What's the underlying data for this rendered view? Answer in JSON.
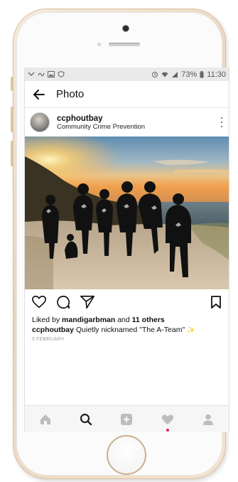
{
  "statusbar": {
    "battery": "73%",
    "time": "11:30"
  },
  "appbar": {
    "title": "Photo"
  },
  "post": {
    "username": "ccphoutbay",
    "location": "Community Crime Prevention",
    "liked_by_prefix": "Liked by ",
    "liked_by_user": "mandigarbman",
    "liked_by_and": " and ",
    "liked_by_others": "11 others",
    "caption_user": "ccphoutbay",
    "caption_text": " Quietly nicknamed \"The A-Team\"",
    "caption_emoji": "✨",
    "date": "5 FEBRUARY"
  },
  "icons": {
    "back": "back-arrow-icon",
    "more": "more-options-icon",
    "like": "heart-outline-icon",
    "comment": "comment-bubble-icon",
    "share": "direct-send-icon",
    "save": "bookmark-icon",
    "tabs": [
      "home-icon",
      "search-icon",
      "add-post-icon",
      "activity-heart-icon",
      "profile-icon"
    ]
  },
  "colors": {
    "accent_notification": "#e0245e",
    "statusbar_bg": "#e9e9e9",
    "tab_inactive": "#bdbdbd",
    "tab_active": "#222222"
  }
}
